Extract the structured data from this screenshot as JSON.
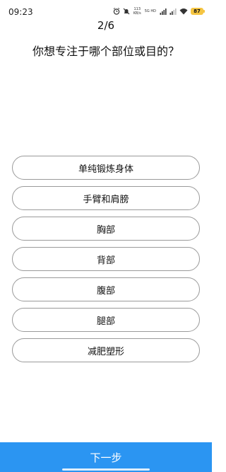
{
  "status_bar": {
    "time": "09:23",
    "icons": [
      "alarm-icon",
      "mute-icon",
      "network-speed",
      "signal-icon",
      "signal-icon",
      "wifi-icon",
      "battery-icon"
    ],
    "net_speed_value": "113",
    "net_speed_unit": "KB/s",
    "net_type": "5G HD",
    "battery_level": "87",
    "battery_color": "#f5c542"
  },
  "header": {
    "step": "2/6",
    "question": "你想专注于哪个部位或目的？"
  },
  "options": [
    {
      "label": "单纯锻炼身体"
    },
    {
      "label": "手臂和肩膀"
    },
    {
      "label": "胸部"
    },
    {
      "label": "背部"
    },
    {
      "label": "腹部"
    },
    {
      "label": "腿部"
    },
    {
      "label": "减肥塑形"
    }
  ],
  "footer": {
    "next_label": "下一步",
    "accent_color": "#2b95f2"
  }
}
